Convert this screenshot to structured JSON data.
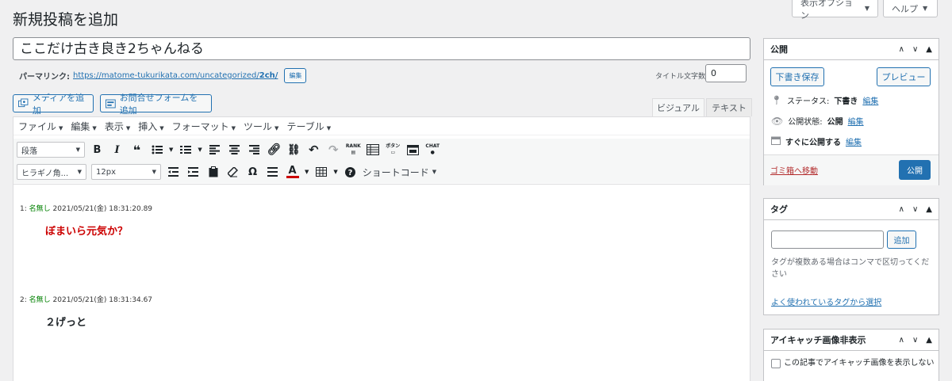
{
  "header": {
    "title": "新規投稿を追加",
    "screen_options": "表示オプション",
    "help": "ヘルプ"
  },
  "post": {
    "title": "ここだけ古き良き2ちゃんねる",
    "permalink_label": "パーマリンク:",
    "permalink_base": "https://matome-tukurikata.com/uncategorized/",
    "permalink_slug": "2ch/",
    "permalink_edit": "編集",
    "title_count_label": "タイトル文字数:",
    "title_count": "0"
  },
  "media": {
    "add_media": "メディアを追加",
    "add_contact_form": "お問合せフォームを追加"
  },
  "editor_tabs": {
    "visual": "ビジュアル",
    "text": "テキスト"
  },
  "menubar": [
    "ファイル",
    "編集",
    "表示",
    "挿入",
    "フォーマット",
    "ツール",
    "テーブル"
  ],
  "toolbar": {
    "format_select": "段落",
    "font_select": "ヒラギノ角...",
    "size_select": "12px",
    "rank": "RANK",
    "button_label": "ボタン",
    "chat": "CHAT",
    "shortcode": "ショートコード"
  },
  "posts": [
    {
      "num": "1:",
      "name": "名無し",
      "date": "2021/05/21(金) 18:31:20.89",
      "body": "ぼまいら元気か？",
      "color": "#cc0000"
    },
    {
      "num": "2:",
      "name": "名無し",
      "date": "2021/05/21(金) 18:31:34.67",
      "body": "２げっと",
      "color": "#1d2327"
    }
  ],
  "publish_box": {
    "title": "公開",
    "save_draft": "下書き保存",
    "preview": "プレビュー",
    "status_label": "ステータス:",
    "status_value": "下書き",
    "status_edit": "編集",
    "visibility_label": "公開状態:",
    "visibility_value": "公開",
    "visibility_edit": "編集",
    "schedule_label": "すぐに公開する",
    "schedule_edit": "編集",
    "trash": "ゴミ箱へ移動",
    "publish": "公開"
  },
  "tags_box": {
    "title": "タグ",
    "add": "追加",
    "help": "タグが複数ある場合はコンマで区切ってください",
    "popular_link": "よく使われているタグから選択"
  },
  "eyecatch_box": {
    "title": "アイキャッチ画像非表示",
    "checkbox_label": "この記事でアイキャッチ画像を表示しない"
  },
  "colors": {
    "accent": "#2271b1",
    "name_green": "#008000",
    "post_red": "#cc0000",
    "trash_red": "#b32d2e"
  }
}
